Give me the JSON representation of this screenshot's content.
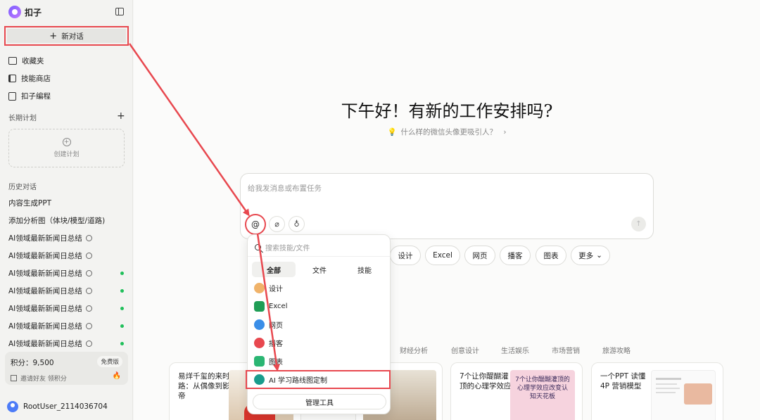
{
  "app": {
    "name": "扣子"
  },
  "sidebar": {
    "new_chat": "新对话",
    "nav": [
      {
        "label": "收藏夹",
        "icon": "folder-icon"
      },
      {
        "label": "技能商店",
        "icon": "book-icon"
      },
      {
        "label": "扣子编程",
        "icon": "code-file-icon"
      }
    ],
    "long_term_plan": "长期计划",
    "create_plan": "创建计划",
    "history_label": "历史对话",
    "history": [
      {
        "title": "内容生成PPT",
        "clock": false,
        "dot": false
      },
      {
        "title": "添加分析图（体块/模型/道路)",
        "clock": false,
        "dot": false
      },
      {
        "title": "AI领域最新新闻日总结",
        "clock": true,
        "dot": false
      },
      {
        "title": "AI领域最新新闻日总结",
        "clock": true,
        "dot": false
      },
      {
        "title": "AI领域最新新闻日总结",
        "clock": true,
        "dot": true
      },
      {
        "title": "AI领域最新新闻日总结",
        "clock": true,
        "dot": true
      },
      {
        "title": "AI领域最新新闻日总结",
        "clock": true,
        "dot": true
      },
      {
        "title": "AI领域最新新闻日总结",
        "clock": true,
        "dot": true
      },
      {
        "title": "AI领域最新新闻日总结",
        "clock": true,
        "dot": true
      }
    ],
    "points_label": "积分：",
    "points_value": "9,500",
    "free_badge": "免费版",
    "invite_text": "邀请好友 领积分",
    "username": "RootUser_2114036704"
  },
  "main": {
    "greeting": "下午好！有新的工作安排吗?",
    "suggestion": "什么样的微信头像更吸引人？",
    "suggestion_arrow": "›",
    "input_placeholder": "给我发消息或布置任务",
    "at_symbol": "@",
    "chips": [
      "设计",
      "Excel",
      "网页",
      "播客",
      "图表",
      "更多"
    ],
    "categories": [
      "财经分析",
      "创意设计",
      "生活娱乐",
      "市场营销",
      "旅游攻略"
    ],
    "cards": [
      {
        "title": "易烊千玺的来时路：从偶像到影帝"
      },
      {
        "title": "7个让你醍醐灌顶的心理学效应",
        "thumb_text": "7个让你醍醐灌顶的心理学效应改变认知天花板"
      },
      {
        "title": "一个PPT 读懂 4P 营销模型"
      }
    ]
  },
  "popup": {
    "search_placeholder": "搜索技能/文件",
    "tabs": [
      "全部",
      "文件",
      "技能"
    ],
    "items": [
      {
        "label": "设计",
        "color": "#f0b36a"
      },
      {
        "label": "Excel",
        "color": "#1f9d55"
      },
      {
        "label": "网页",
        "color": "#3a8ee8"
      },
      {
        "label": "播客",
        "color": "#e8484f"
      },
      {
        "label": "图表",
        "color": "#2bb673"
      },
      {
        "label": "AI 学习路线图定制",
        "color": "#1a9c8c"
      }
    ],
    "manage": "管理工具"
  },
  "colors": {
    "highlight": "#e8484f",
    "accent": "#7a5cff",
    "green_dot": "#1fbf5a"
  }
}
